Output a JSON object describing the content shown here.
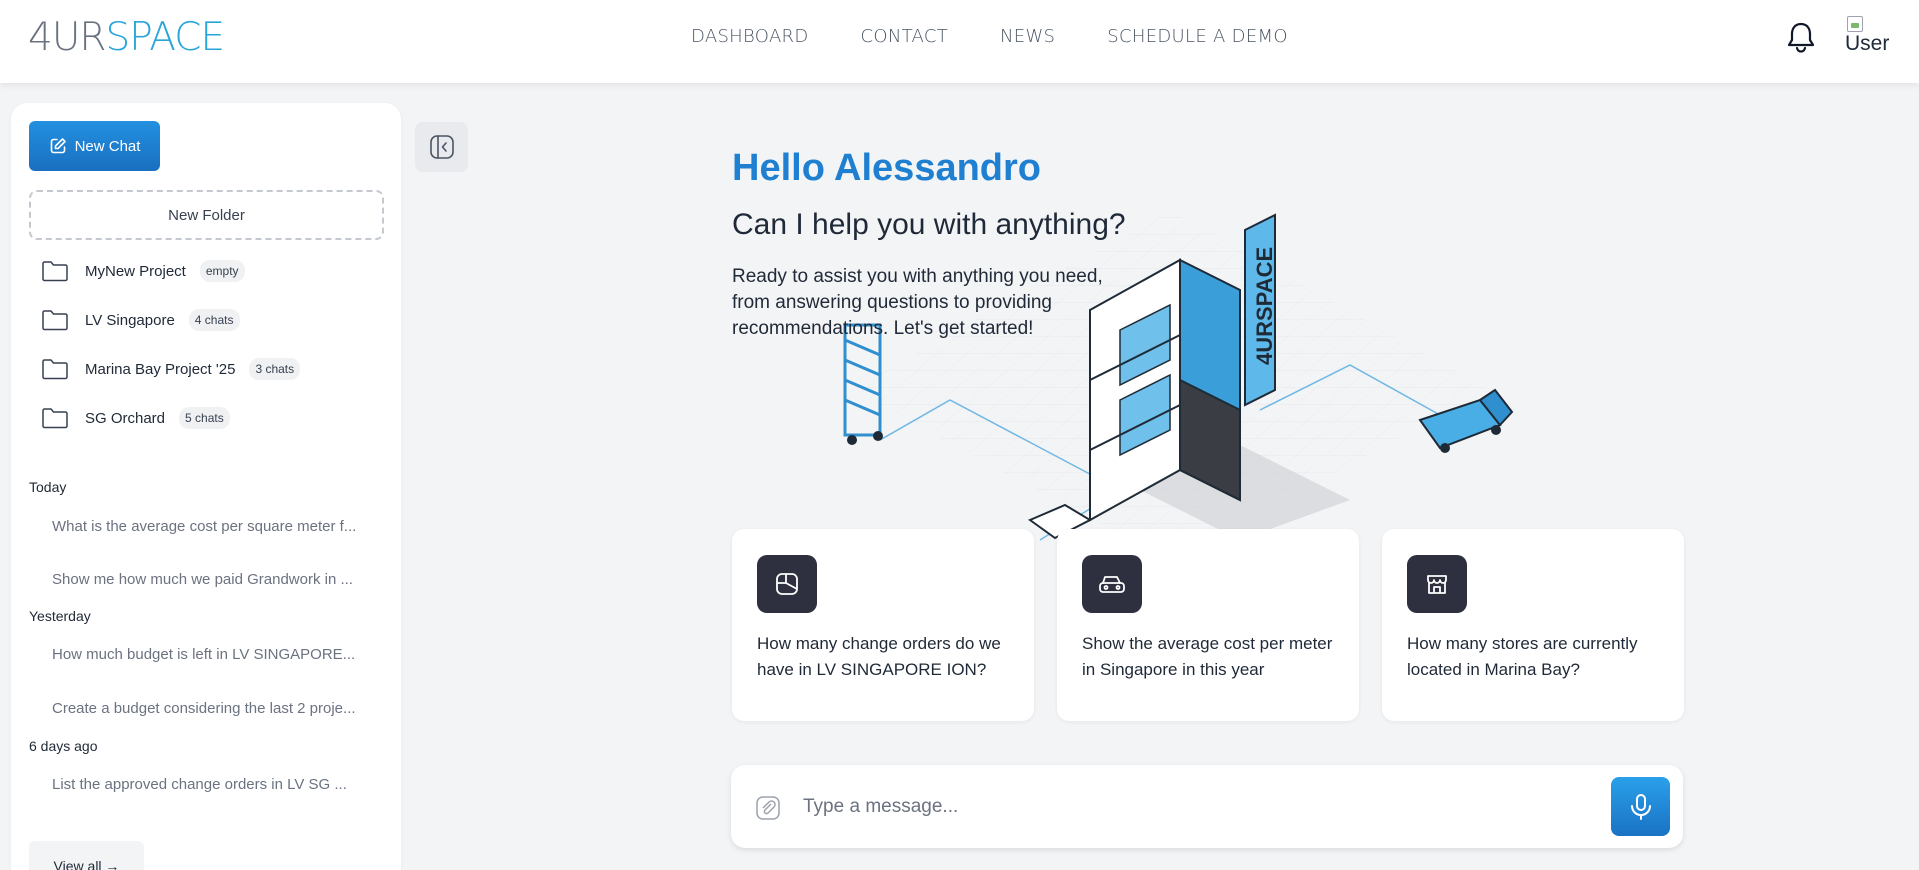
{
  "header": {
    "logo_part1": "4UR",
    "logo_part2": "SPACE",
    "nav": [
      "DASHBOARD",
      "CONTACT",
      "NEWS",
      "SCHEDULE A DEMO"
    ],
    "user_alt": "User"
  },
  "sidebar": {
    "new_chat_label": "New Chat",
    "new_folder_label": "New Folder",
    "folders": [
      {
        "name": "MyNew Project",
        "badge": "empty"
      },
      {
        "name": "LV Singapore",
        "badge": "4 chats"
      },
      {
        "name": "Marina Bay Project '25",
        "badge": "3 chats"
      },
      {
        "name": "SG Orchard",
        "badge": "5 chats"
      }
    ],
    "sections": [
      {
        "label": "Today",
        "items": [
          "What is the average cost per square meter f...",
          "Show me how much we paid Grandwork in ..."
        ]
      },
      {
        "label": "Yesterday",
        "items": [
          "How much budget is left in LV SINGAPORE...",
          "Create a budget considering the last 2 proje..."
        ]
      },
      {
        "label": "6 days ago",
        "items": [
          "List the approved change orders in LV SG ..."
        ]
      }
    ],
    "view_all_label": "View all →"
  },
  "main": {
    "greeting": "Hello Alessandro",
    "subtitle": "Can I help you with anything?",
    "intro": "Ready to assist you with anything you need, from answering questions to providing recommendations. Let's get started!",
    "illustration_brand": "4URSPACE",
    "cards": [
      {
        "icon": "layout-icon",
        "text": "How many change orders do we have in LV SINGAPORE ION?"
      },
      {
        "icon": "car-icon",
        "text": "Show the average cost per meter in Singapore in this year"
      },
      {
        "icon": "store-icon",
        "text": "How many stores are currently located in Marina Bay?"
      }
    ],
    "composer": {
      "placeholder": "Type a message..."
    }
  },
  "colors": {
    "accent": "#1f7fd1",
    "logo_blue": "#29a6d9",
    "card_icon_bg": "#2e2f3f"
  }
}
